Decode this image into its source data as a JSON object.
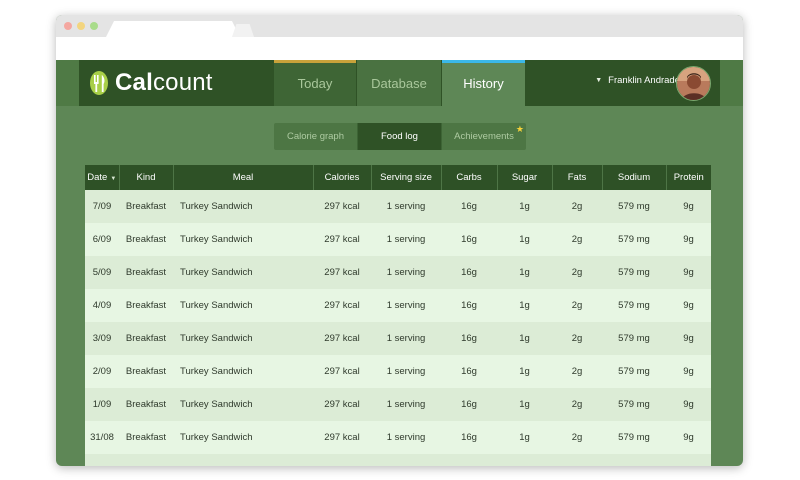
{
  "app": {
    "logo_bold": "Cal",
    "logo_rest": "count",
    "user_name": "Franklin Andrade"
  },
  "nav": {
    "tabs": [
      {
        "label": "Today",
        "accent": "#c8a23a"
      },
      {
        "label": "Database",
        "accent": null
      },
      {
        "label": "History",
        "accent": "#3bb8e8",
        "active": true
      }
    ]
  },
  "subtabs": [
    {
      "label": "Calorie graph"
    },
    {
      "label": "Food log",
      "active": true
    },
    {
      "label": "Achievements",
      "badge_icon": "star-icon"
    }
  ],
  "table": {
    "columns": [
      "Date",
      "Kind",
      "Meal",
      "Calories",
      "Serving size",
      "Carbs",
      "Sugar",
      "Fats",
      "Sodium",
      "Protein"
    ],
    "rows": [
      [
        "7/09",
        "Breakfast",
        "Turkey Sandwich",
        "297 kcal",
        "1 serving",
        "16g",
        "1g",
        "2g",
        "579 mg",
        "9g"
      ],
      [
        "6/09",
        "Breakfast",
        "Turkey Sandwich",
        "297 kcal",
        "1 serving",
        "16g",
        "1g",
        "2g",
        "579 mg",
        "9g"
      ],
      [
        "5/09",
        "Breakfast",
        "Turkey Sandwich",
        "297 kcal",
        "1 serving",
        "16g",
        "1g",
        "2g",
        "579 mg",
        "9g"
      ],
      [
        "4/09",
        "Breakfast",
        "Turkey Sandwich",
        "297 kcal",
        "1 serving",
        "16g",
        "1g",
        "2g",
        "579 mg",
        "9g"
      ],
      [
        "3/09",
        "Breakfast",
        "Turkey Sandwich",
        "297 kcal",
        "1 serving",
        "16g",
        "1g",
        "2g",
        "579 mg",
        "9g"
      ],
      [
        "2/09",
        "Breakfast",
        "Turkey Sandwich",
        "297 kcal",
        "1 serving",
        "16g",
        "1g",
        "2g",
        "579 mg",
        "9g"
      ],
      [
        "1/09",
        "Breakfast",
        "Turkey Sandwich",
        "297 kcal",
        "1 serving",
        "16g",
        "1g",
        "2g",
        "579 mg",
        "9g"
      ],
      [
        "31/08",
        "Breakfast",
        "Turkey Sandwich",
        "297 kcal",
        "1 serving",
        "16g",
        "1g",
        "2g",
        "579 mg",
        "9g"
      ],
      [
        "",
        "",
        "",
        "",
        "",
        "",
        "",
        "",
        "",
        ""
      ]
    ]
  },
  "colors": {
    "page_bg": "#5e8756",
    "header_bg": "#2f5226",
    "row_odd": "#dcecd6",
    "row_even": "#e7f6e3"
  }
}
